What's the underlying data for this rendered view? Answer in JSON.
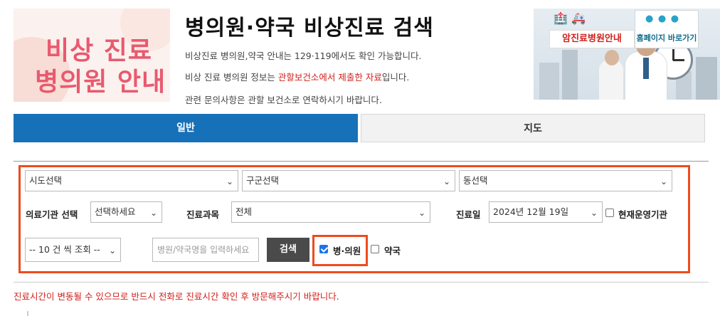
{
  "header": {
    "banner_line1": "비상 진료",
    "banner_line2": "병의원 안내",
    "title": "병의원·약국 비상진료 검색",
    "info1": "비상진료 병의원,약국 안내는 129·119에서도 확인 가능합니다.",
    "info2_prefix": "비상 진료 병의원 정보는 ",
    "info2_highlight": "관할보건소에서 제출한 자료",
    "info2_suffix": "입니다.",
    "info3": "관련 문의사항은 관할 보건소로 연락하시기 바랍니다."
  },
  "promo": {
    "cancer_hospital_button": "암진료병원안내",
    "homepage_button": "홈페이지 바로가기"
  },
  "tabs": [
    {
      "label": "일반",
      "active": true
    },
    {
      "label": "지도",
      "active": false
    }
  ],
  "search": {
    "sido": "시도선택",
    "gugun": "구군선택",
    "dong": "동선택",
    "institution_label": "의료기관 선택",
    "institution_value": "선택하세요",
    "department_label": "진료과목",
    "department_value": "전체",
    "date_label": "진료일",
    "date_value": "2024년 12월 19일",
    "open_now_label": "현재운영기관",
    "open_now_checked": false,
    "count_value": "-- 10 건 씩 조회 --",
    "name_placeholder": "병원/약국명을 입력하세요",
    "search_button": "검색",
    "hospital_label": "병·의원",
    "hospital_checked": true,
    "pharmacy_label": "약국",
    "pharmacy_checked": false
  },
  "notice": "진료시간이 변동될 수 있으므로 반드시 전화로 진료시간 확인 후 방문해주시기 바랍니다.",
  "colors": {
    "tab_active": "#1771b8",
    "highlight_border": "#ee4b1e",
    "notice_red": "#d0211c",
    "search_button": "#4a4a4a"
  }
}
